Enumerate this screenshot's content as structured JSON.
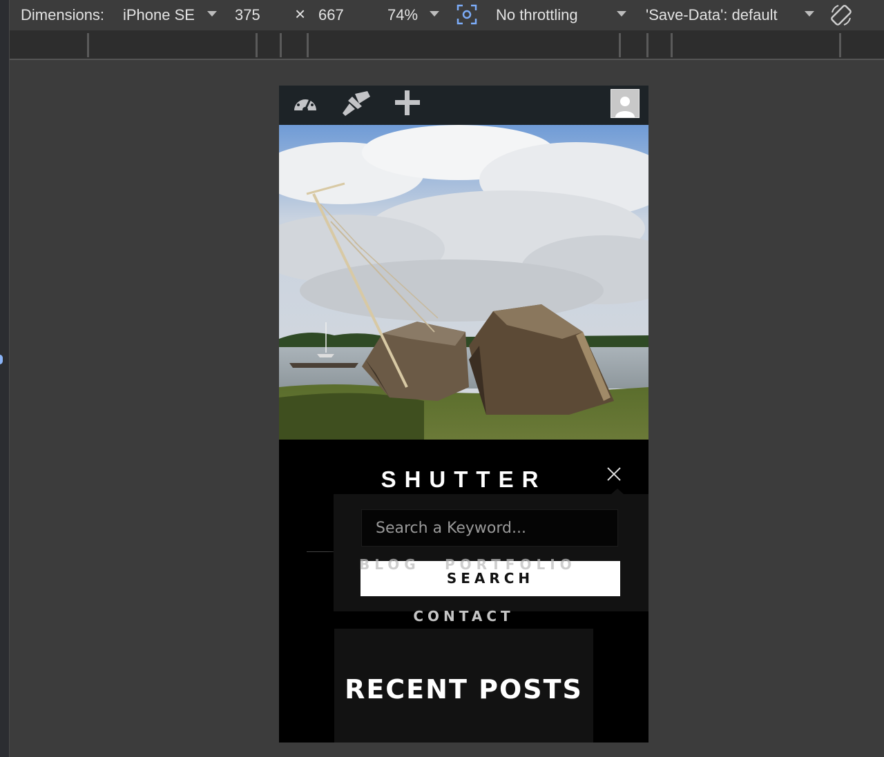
{
  "devtools": {
    "dimensions_label": "Dimensions:",
    "device": "iPhone SE",
    "width": "375",
    "times": "×",
    "height": "667",
    "zoom": "74%",
    "throttling": "No throttling",
    "save_data": "'Save-Data': default"
  },
  "admin_bar": {
    "icons": [
      "dashboard-icon",
      "customize-brush-icon",
      "plus-icon",
      "avatar"
    ]
  },
  "site": {
    "title": "SHUTTER",
    "search_placeholder": "Search a Keyword...",
    "search_button": "SEARCH",
    "menu": [
      "BLOG",
      "PORTFOLIO",
      "CONTACT"
    ],
    "recent_posts": "RECENT POSTS"
  },
  "colors": {
    "page_bg": "#3c3c3c",
    "admin_bar": "#1d2327",
    "site_bg": "#000000",
    "panel_bg": "#121212"
  }
}
